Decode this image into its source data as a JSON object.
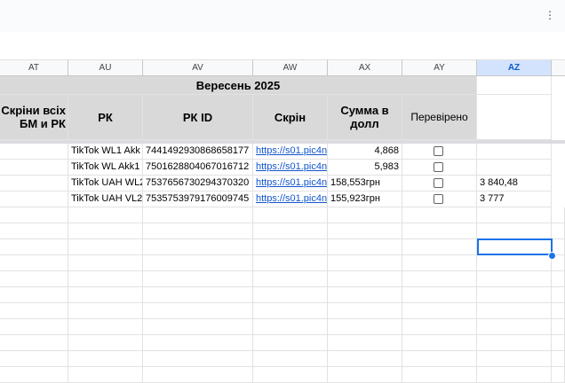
{
  "columns": [
    "AT",
    "AU",
    "AV",
    "AW",
    "AX",
    "AY",
    "AZ"
  ],
  "selected_column": "AZ",
  "header": {
    "merged_title": "Вересень 2025",
    "at": "Скріни всіх БМ и РК",
    "au": "РК",
    "av": "РК ID",
    "aw": "Скрін",
    "ax": "Сумма в долл",
    "ay": "Перевірено"
  },
  "rows": [
    {
      "rk": "TikTok WL1 Akk",
      "rk_id": "7441492930868658177",
      "screen": "https://s01.pic4n",
      "sum": "4,868",
      "checked": false,
      "az": ""
    },
    {
      "rk": "TikTok WL Akk1",
      "rk_id": "7501628804067016712",
      "screen": "https://s01.pic4n",
      "sum": "5,983",
      "checked": false,
      "az": ""
    },
    {
      "rk": "TikTok UAH WL2",
      "rk_id": "7537656730294370320",
      "screen": "https://s01.pic4n",
      "sum": "158,553грн",
      "checked": false,
      "az": "3 840,48"
    },
    {
      "rk": "TikTok UAH VL2",
      "rk_id": "7535753979176009745",
      "screen": "https://s01.pic4n",
      "sum": "155,923грн",
      "checked": false,
      "az": "3 777"
    }
  ]
}
